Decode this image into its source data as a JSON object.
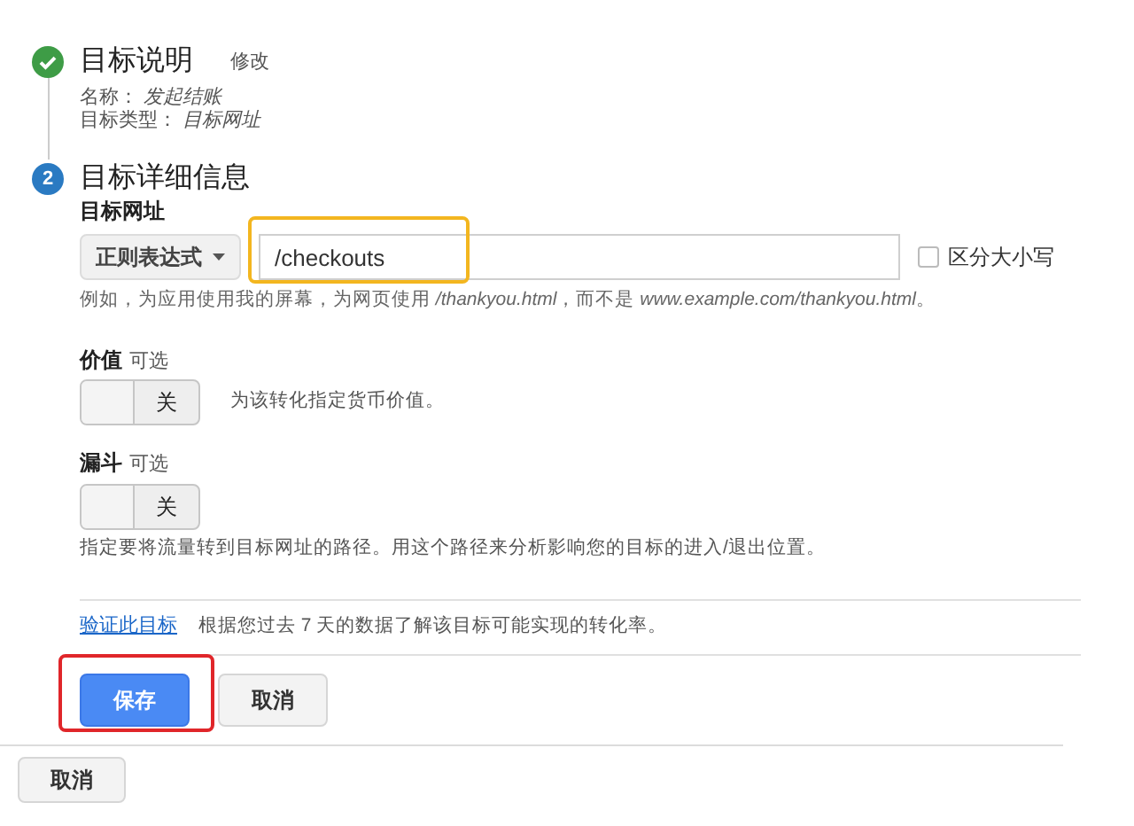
{
  "steps": [
    {
      "done": true,
      "title": "目标说明",
      "edit_link": "修改",
      "details": [
        {
          "label": "名称：",
          "value": "发起结账"
        },
        {
          "label": "目标类型：",
          "value": "目标网址"
        }
      ]
    },
    {
      "number": "2",
      "done": false,
      "title": "目标详细信息"
    }
  ],
  "destination": {
    "label": "目标网址",
    "match_type": "正则表达式",
    "value": "/checkouts",
    "highlighted": true,
    "case_sensitive": {
      "label": "区分大小写",
      "checked": false
    },
    "hint": "例如，为应用使用我的屏幕，为网页使用 */thankyou.html*，而不是 *www.example.com/thankyou.html*。"
  },
  "options": [
    {
      "label": "价值",
      "optional": "可选",
      "toggle": {
        "on": false,
        "label": "关"
      },
      "description": "为该转化指定货币价值。",
      "inline": true
    },
    {
      "label": "漏斗",
      "optional": "可选",
      "toggle": {
        "on": false,
        "label": "关"
      },
      "description": "指定要将流量转到目标网址的路径。用这个路径来分析影响您的目标的进入/退出位置。",
      "inline": false
    }
  ],
  "verify": {
    "link": "验证此目标",
    "description": "根据您过去 7 天的数据了解该目标可能实现的转化率。"
  },
  "actions": [
    {
      "label": "保存",
      "primary": true,
      "highlighted": true
    },
    {
      "label": "取消",
      "primary": false,
      "highlighted": false
    }
  ],
  "footer_button": "取消"
}
